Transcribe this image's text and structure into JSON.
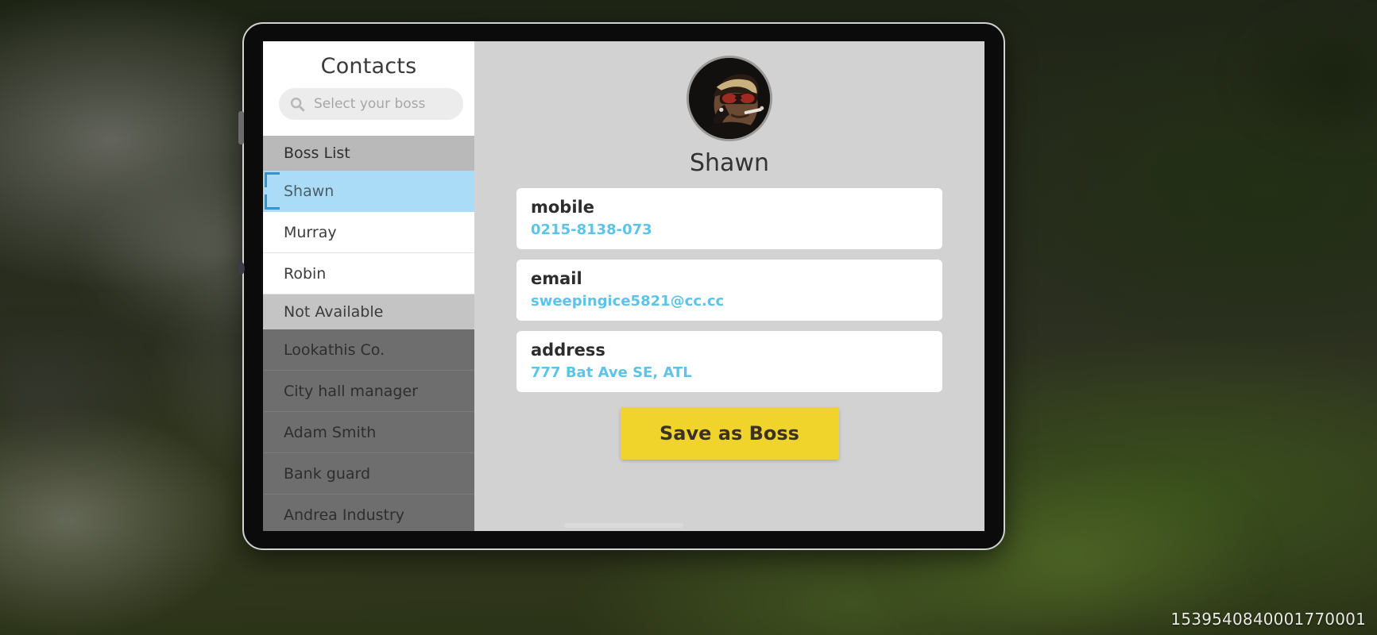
{
  "watermark": "1539540840001770001",
  "contacts_panel": {
    "title": "Contacts",
    "search": {
      "icon": "search-icon",
      "placeholder": "Select your boss",
      "value": ""
    },
    "groups": [
      {
        "header": "Boss List",
        "available": true,
        "items": [
          {
            "label": "Shawn",
            "selected": true
          },
          {
            "label": "Murray",
            "selected": false
          },
          {
            "label": "Robin",
            "selected": false
          }
        ]
      },
      {
        "header": "Not Available",
        "available": false,
        "items": [
          {
            "label": "Lookathis Co.",
            "selected": false
          },
          {
            "label": "City hall manager",
            "selected": false
          },
          {
            "label": "Adam Smith",
            "selected": false
          },
          {
            "label": "Bank guard",
            "selected": false
          },
          {
            "label": "Andrea Industry",
            "selected": false
          }
        ]
      }
    ]
  },
  "detail_panel": {
    "avatar_icon": "contact-avatar-shawn",
    "name": "Shawn",
    "fields": [
      {
        "label": "mobile",
        "value": "0215-8138-073"
      },
      {
        "label": "email",
        "value": "sweepingice5821@cc.cc"
      },
      {
        "label": "address",
        "value": "777 Bat Ave SE, ATL"
      }
    ],
    "save_button": "Save as Boss"
  },
  "colors": {
    "accent_value": "#5cc4e8",
    "save_button": "#f0d42b",
    "selected_row": "#aadcf7",
    "selection_bracket": "#2f93d6",
    "group_header": "#b9b9b9",
    "disabled_row": "#6e6e6e",
    "detail_background": "#d2d2d2"
  }
}
